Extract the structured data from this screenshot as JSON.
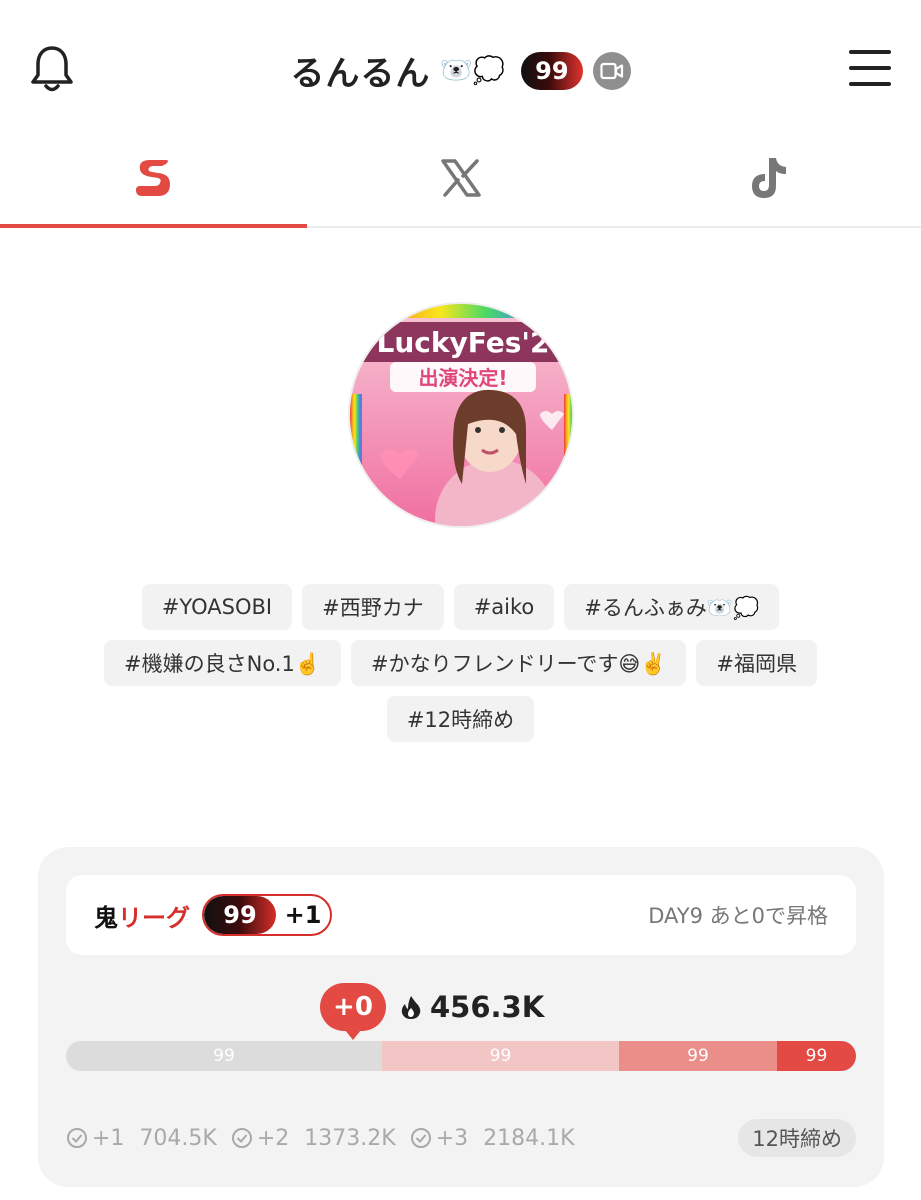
{
  "header": {
    "title": "るんるん",
    "title_emoji": "🐻‍❄️💭",
    "rank_badge": "99"
  },
  "tabs": [
    {
      "name": "showroom",
      "active": true
    },
    {
      "name": "x",
      "active": false
    },
    {
      "name": "tiktok",
      "active": false
    }
  ],
  "tags": [
    "#YOASOBI",
    "#西野カナ",
    "#aiko",
    "#るんふぁみ🐻‍❄️💭",
    "#機嫌の良さNo.1☝️",
    "#かなりフレンドリーです😅✌️",
    "#福岡県",
    "#12時締め"
  ],
  "league": {
    "name_prefix": "鬼",
    "name_suffix": "リーグ",
    "rank": "99",
    "rank_delta": "+1",
    "status": "DAY9 あと0で昇格",
    "delta": "+0",
    "points": "456.3K",
    "bar_segments": [
      {
        "label": "99",
        "fraction": 0.4,
        "color": "#dcdcdc"
      },
      {
        "label": "99",
        "fraction": 0.3,
        "color": "#f2c6c4"
      },
      {
        "label": "99",
        "fraction": 0.2,
        "color": "#ea8e89"
      },
      {
        "label": "99",
        "fraction": 0.1,
        "color": "#e24a43"
      }
    ],
    "goals": [
      {
        "label": "+1",
        "value": "704.5K"
      },
      {
        "label": "+2",
        "value": "1373.2K"
      },
      {
        "label": "+3",
        "value": "2184.1K"
      }
    ],
    "deadline": "12時締め"
  },
  "colors": {
    "accent": "#e24a43",
    "tag_bg": "#f2f2f2",
    "card_bg": "#f3f3f3"
  }
}
